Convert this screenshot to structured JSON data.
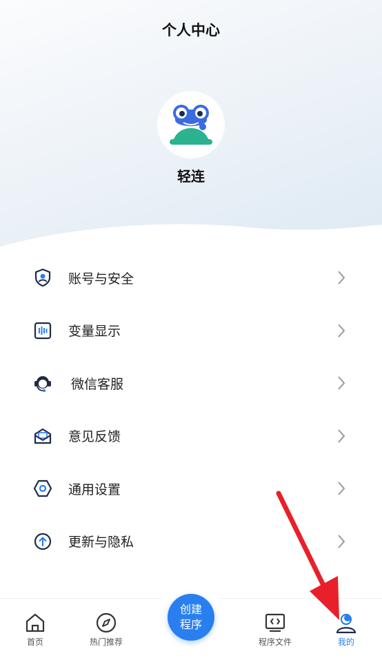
{
  "header": {
    "title": "个人中心"
  },
  "profile": {
    "name": "轻连",
    "avatar_icon": "frog-avatar-icon"
  },
  "menu": [
    {
      "label": "账号与安全",
      "icon": "account-shield-icon"
    },
    {
      "label": "变量显示",
      "icon": "variable-display-icon"
    },
    {
      "label": "微信客服",
      "icon": "headset-support-icon"
    },
    {
      "label": "意见反馈",
      "icon": "feedback-mail-icon"
    },
    {
      "label": "通用设置",
      "icon": "settings-hexagon-icon"
    },
    {
      "label": "更新与隐私",
      "icon": "update-arrow-icon"
    }
  ],
  "tabbar": {
    "home": "首页",
    "hot": "热门推荐",
    "create_line1": "创建",
    "create_line2": "程序",
    "files": "程序文件",
    "mine": "我的"
  },
  "colors": {
    "accent": "#2a7ff0",
    "annotation_arrow": "#e8202a"
  }
}
